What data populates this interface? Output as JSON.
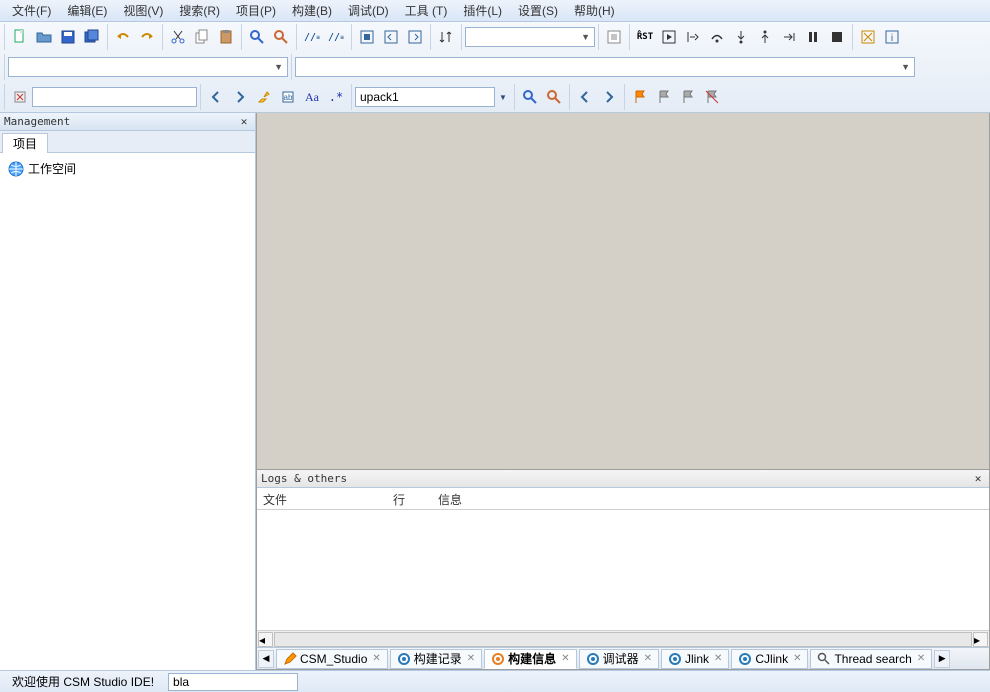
{
  "menubar": {
    "items": [
      "文件(F)",
      "编辑(E)",
      "视图(V)",
      "搜索(R)",
      "项目(P)",
      "构建(B)",
      "调试(D)",
      "工具 (T)",
      "插件(L)",
      "设置(S)",
      "帮助(H)"
    ]
  },
  "toolbar": {
    "row1_combo_value": "",
    "search_value": "upack1"
  },
  "sidebar": {
    "title": "Management",
    "tabs": [
      {
        "label": "项目"
      }
    ],
    "tree": [
      {
        "label": "工作空间"
      }
    ]
  },
  "logs": {
    "title": "Logs & others",
    "columns": {
      "file": "文件",
      "line": "行",
      "msg": "信息"
    }
  },
  "bottom_tabs": {
    "items": [
      {
        "label": "CSM_Studio",
        "icon": "edit",
        "active": false
      },
      {
        "label": "构建记录",
        "icon": "gear",
        "active": false
      },
      {
        "label": "构建信息",
        "icon": "build-orange",
        "active": true
      },
      {
        "label": "调试器",
        "icon": "gear",
        "active": false
      },
      {
        "label": "Jlink",
        "icon": "gear",
        "active": false
      },
      {
        "label": "CJlink",
        "icon": "gear",
        "active": false
      },
      {
        "label": "Thread search",
        "icon": "search",
        "active": false
      }
    ]
  },
  "statusbar": {
    "welcome": "欢迎使用 CSM Studio IDE!",
    "input_value": "bla"
  }
}
